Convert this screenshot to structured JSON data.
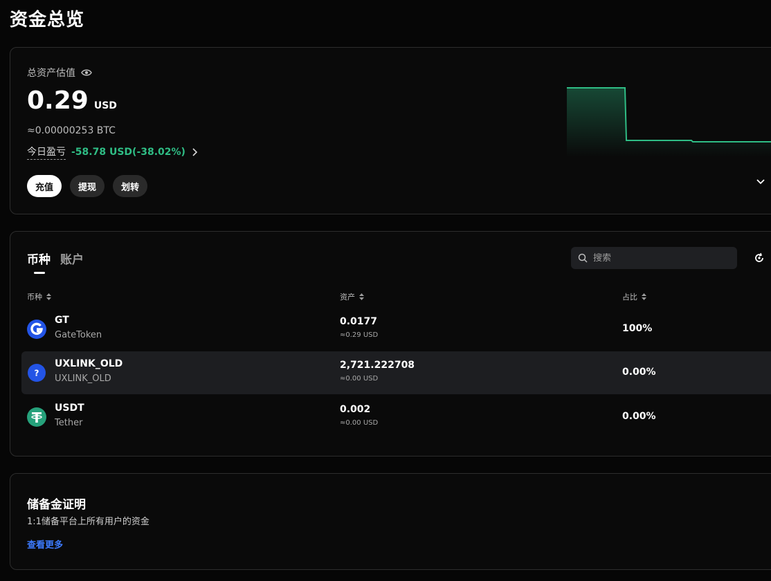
{
  "page": {
    "title": "资金总览"
  },
  "overview": {
    "label": "总资产估值",
    "value": "0.29",
    "unit": "USD",
    "btc": "≈0.00000253 BTC",
    "pnl_label": "今日盈亏",
    "pnl_value": "-58.78 USD(-38.02%)",
    "buttons": {
      "deposit": "充值",
      "withdraw": "提现",
      "transfer": "划转"
    },
    "colors": {
      "positive": "#2fbd85"
    }
  },
  "assets": {
    "tabs": [
      "币种",
      "账户"
    ],
    "search_placeholder": "搜索",
    "columns": {
      "coin": "币种",
      "asset": "资产",
      "ratio": "占比"
    },
    "rows": [
      {
        "symbol": "GT",
        "name": "GateToken",
        "amount": "0.0177",
        "usd": "≈0.29 USD",
        "ratio": "100%",
        "icon": "gatetoken-icon"
      },
      {
        "symbol": "UXLINK_OLD",
        "name": "UXLINK_OLD",
        "amount": "2,721.222708",
        "usd": "≈0.00 USD",
        "ratio": "0.00%",
        "icon": "unknown-coin-icon"
      },
      {
        "symbol": "USDT",
        "name": "Tether",
        "amount": "0.002",
        "usd": "≈0.00 USD",
        "ratio": "0.00%",
        "icon": "tether-icon"
      }
    ]
  },
  "reserve": {
    "title": "储备金证明",
    "description": "1:1储备平台上所有用户的资金",
    "link": "查看更多",
    "link_color": "#3d7bff"
  }
}
